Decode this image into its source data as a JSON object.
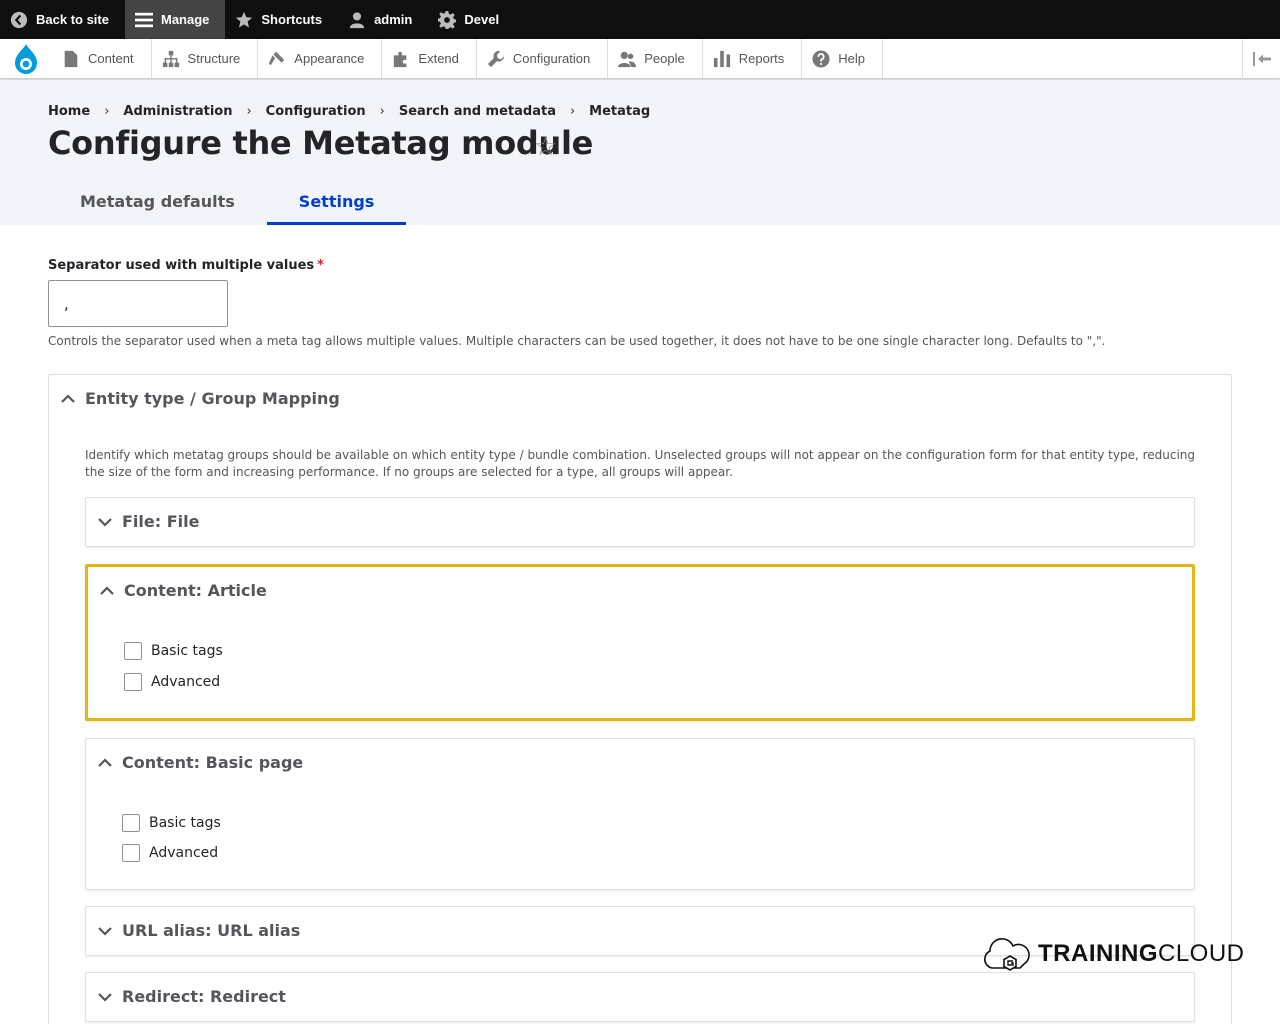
{
  "toolbar": {
    "back_to_site": "Back to site",
    "manage": "Manage",
    "shortcuts": "Shortcuts",
    "user": "admin",
    "devel": "Devel"
  },
  "tray": {
    "items": [
      "Content",
      "Structure",
      "Appearance",
      "Extend",
      "Configuration",
      "People",
      "Reports",
      "Help"
    ]
  },
  "breadcrumb": [
    "Home",
    "Administration",
    "Configuration",
    "Search and metadata",
    "Metatag"
  ],
  "page_title": "Configure the Metatag module",
  "tabs": [
    {
      "label": "Metatag defaults",
      "active": false
    },
    {
      "label": "Settings",
      "active": true
    }
  ],
  "separator_field": {
    "label": "Separator used with multiple values",
    "required_mark": "*",
    "value": ",",
    "description": "Controls the separator used when a meta tag allows multiple values. Multiple characters can be used together, it does not have to be one single character long. Defaults to \",\"."
  },
  "mapping": {
    "title": "Entity type / Group Mapping",
    "description": "Identify which metatag groups should be available on which entity type / bundle combination. Unselected groups will not appear on the configuration form for that entity type, reducing the size of the form and increasing performance. If no groups are selected for a type, all groups will appear.",
    "panels": [
      {
        "title": "File: File",
        "expanded": false
      },
      {
        "title": "Content: Article",
        "expanded": true,
        "options": [
          "Basic tags",
          "Advanced"
        ]
      },
      {
        "title": "Content: Basic page",
        "expanded": true,
        "options": [
          "Basic tags",
          "Advanced"
        ]
      },
      {
        "title": "URL alias: URL alias",
        "expanded": false
      },
      {
        "title": "Redirect: Redirect",
        "expanded": false
      }
    ]
  },
  "watermark": {
    "bold": "TRAINING",
    "rest": "CLOUD"
  },
  "colors": {
    "toolbar_bg": "#0f0f0f",
    "accent": "#003ecc",
    "focus": "#e2b714",
    "header_bg": "#f3f4f9"
  }
}
